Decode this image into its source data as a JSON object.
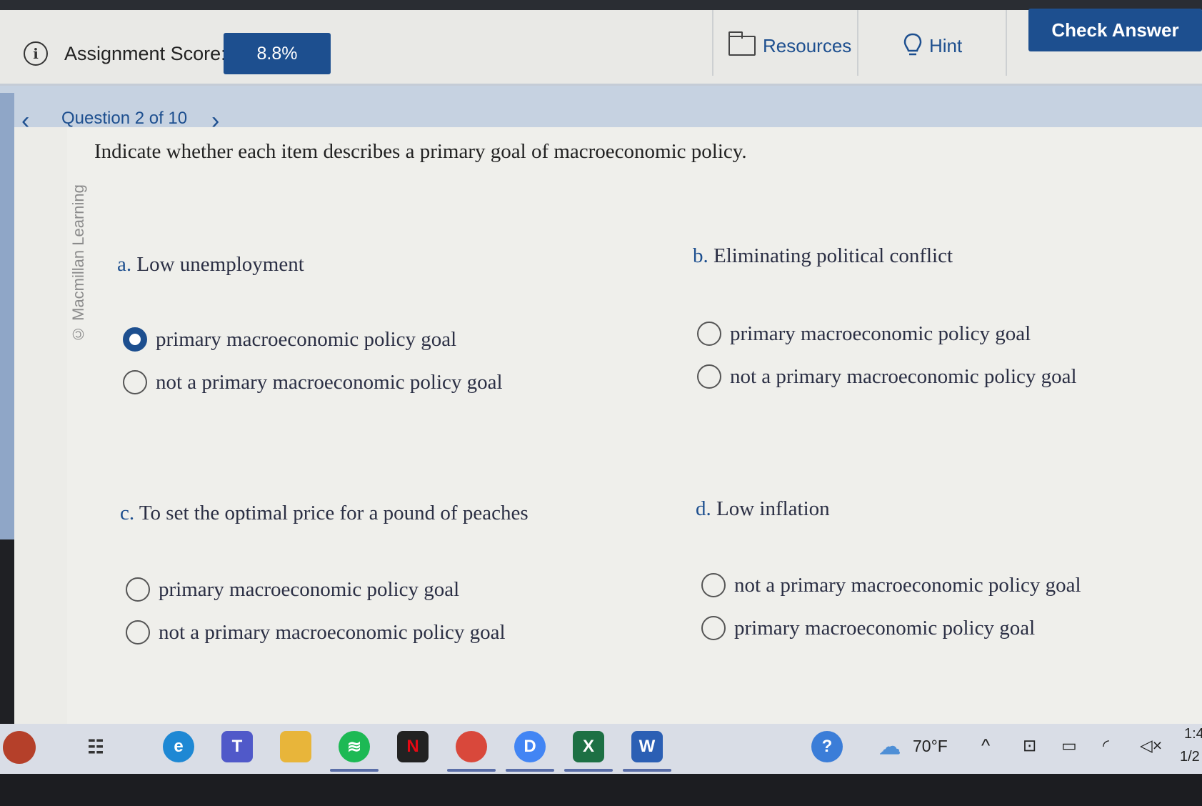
{
  "header": {
    "score_label": "Assignment Score:",
    "score_value": "8.8%",
    "resources_label": "Resources",
    "hint_label": "Hint",
    "check_answer_label": "Check Answer"
  },
  "nav": {
    "question_label": "Question 2 of 10"
  },
  "watermark": "© Macmillan Learning",
  "question": {
    "prompt": "Indicate whether each item describes a primary goal of macroeconomic policy.",
    "items": [
      {
        "letter": "a.",
        "text": "Low unemployment",
        "options": [
          {
            "label": "primary macroeconomic policy goal",
            "selected": true
          },
          {
            "label": "not a primary macroeconomic policy goal",
            "selected": false
          }
        ]
      },
      {
        "letter": "b.",
        "text": "Eliminating political conflict",
        "options": [
          {
            "label": "primary macroeconomic policy goal",
            "selected": false
          },
          {
            "label": "not a primary macroeconomic policy goal",
            "selected": false
          }
        ]
      },
      {
        "letter": "c.",
        "text": "To set the optimal price for a pound of peaches",
        "options": [
          {
            "label": "primary macroeconomic policy goal",
            "selected": false
          },
          {
            "label": "not a primary macroeconomic policy goal",
            "selected": false
          }
        ]
      },
      {
        "letter": "d.",
        "text": "Low inflation",
        "options": [
          {
            "label": "not a primary macroeconomic policy goal",
            "selected": false
          },
          {
            "label": "primary macroeconomic policy goal",
            "selected": false
          }
        ]
      }
    ]
  },
  "taskbar": {
    "weather": "70°F",
    "clock_time": "1:4",
    "clock_date": "1/2",
    "apps": [
      "widgets-icon",
      "edge-icon",
      "teams-icon",
      "file-explorer-icon",
      "spotify-icon",
      "netflix-icon",
      "chrome-profile-icon",
      "chrome-icon",
      "excel-icon",
      "word-icon"
    ]
  },
  "colors": {
    "accent": "#1d4f8f",
    "nav_bar": "#c6d2e1",
    "content_bg": "#efefeb"
  }
}
